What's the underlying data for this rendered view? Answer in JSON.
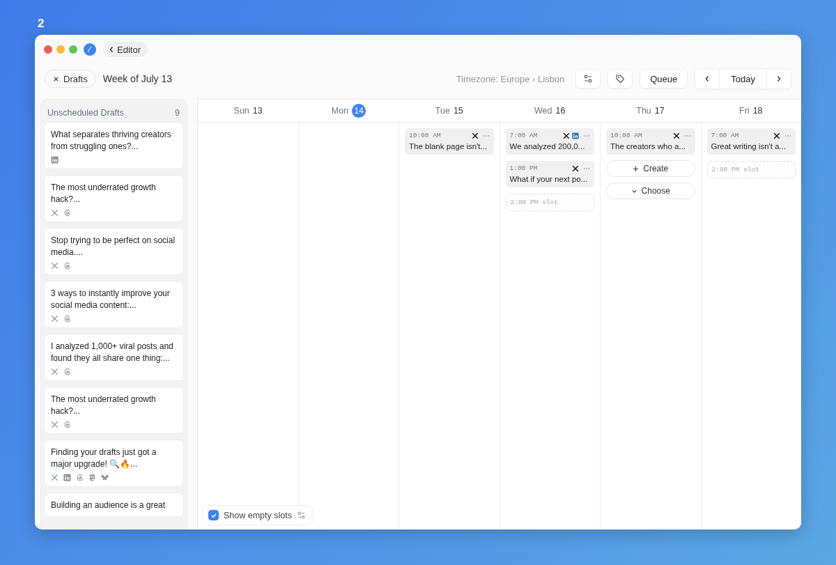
{
  "page_number": "2",
  "titlebar": {
    "back_button": "Editor"
  },
  "toolbar": {
    "close_button": "Drafts",
    "week_title": "Week of July 13",
    "timezone": "Timezone: Europe › Lisbon",
    "queue_button": "Queue",
    "today_button": "Today"
  },
  "drafts": {
    "title": "Unscheduled Drafts",
    "count": "9",
    "items": [
      {
        "text": "What separates thriving creators from struggling ones?...",
        "platforms": [
          {
            "kind": "linkedin"
          }
        ]
      },
      {
        "text": "The most underrated growth hack?...",
        "platforms": [
          {
            "kind": "x"
          },
          {
            "kind": "threads"
          }
        ]
      },
      {
        "text": "Stop trying to be perfect on social media....",
        "platforms": [
          {
            "kind": "x"
          },
          {
            "kind": "threads"
          }
        ]
      },
      {
        "text": "3 ways to instantly improve your social media content:...",
        "platforms": [
          {
            "kind": "x"
          },
          {
            "kind": "threads"
          }
        ]
      },
      {
        "text": "I analyzed 1,000+ viral posts and found they all share one thing:...",
        "platforms": [
          {
            "kind": "x"
          },
          {
            "kind": "threads"
          }
        ]
      },
      {
        "text": "The most underrated growth hack?...",
        "platforms": [
          {
            "kind": "x"
          },
          {
            "kind": "threads"
          }
        ]
      },
      {
        "text": "Finding your drafts just got a major upgrade! 🔍🔥...",
        "platforms": [
          {
            "kind": "x"
          },
          {
            "kind": "linkedin"
          },
          {
            "kind": "threads"
          },
          {
            "kind": "mastodon"
          },
          {
            "kind": "bluesky"
          }
        ]
      },
      {
        "text": "Building an audience is a great"
      }
    ]
  },
  "days": [
    {
      "name": "Sun",
      "date": "13",
      "selected": false
    },
    {
      "name": "Mon",
      "date": "14",
      "selected": true
    },
    {
      "name": "Tue",
      "date": "15",
      "selected": false,
      "items": [
        {
          "kind": "post",
          "time": "10:00 AM",
          "text": "The blank page isn't...",
          "platforms": [
            {
              "kind": "x"
            }
          ]
        }
      ]
    },
    {
      "name": "Wed",
      "date": "16",
      "selected": false,
      "items": [
        {
          "kind": "post",
          "time": "7:00 AM",
          "text": "We analyzed 200,0...",
          "platforms": [
            {
              "kind": "x"
            },
            {
              "kind": "linkedin"
            }
          ]
        },
        {
          "kind": "post",
          "time": "1:00 PM",
          "text": "What if your next po...",
          "platforms": [
            {
              "kind": "x"
            }
          ]
        },
        {
          "kind": "slot",
          "text": "2:00 PM slot"
        }
      ]
    },
    {
      "name": "Thu",
      "date": "17",
      "selected": false,
      "items": [
        {
          "kind": "post",
          "time": "10:00 AM",
          "text": "The creators who a...",
          "platforms": [
            {
              "kind": "x"
            }
          ]
        },
        {
          "kind": "create",
          "text": "Create"
        },
        {
          "kind": "choose",
          "text": "Choose"
        }
      ]
    },
    {
      "name": "Fri",
      "date": "18",
      "selected": false,
      "items": [
        {
          "kind": "post",
          "time": "7:00 AM",
          "text": "Great writing isn't a...",
          "platforms": [
            {
              "kind": "x"
            }
          ]
        },
        {
          "kind": "slot",
          "text": "2:00 PM slot"
        }
      ]
    }
  ],
  "show_empty_slots": {
    "label": "Show empty slots",
    "checked": true
  }
}
